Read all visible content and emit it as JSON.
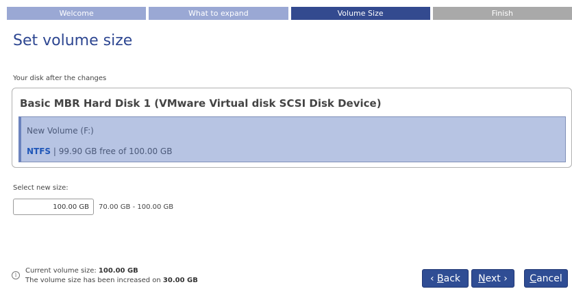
{
  "steps": [
    {
      "label": "Welcome",
      "state": "done"
    },
    {
      "label": "What to expand",
      "state": "done"
    },
    {
      "label": "Volume Size",
      "state": "active"
    },
    {
      "label": "Finish",
      "state": "pending"
    }
  ],
  "page": {
    "title": "Set volume size",
    "disk_section_label": "Your disk after the changes"
  },
  "disk": {
    "title": "Basic MBR Hard Disk 1 (VMware Virtual disk SCSI Disk Device)",
    "volume": {
      "name": "New Volume (F:)",
      "filesystem": "NTFS",
      "separator": " | ",
      "free_text": "99.90 GB free of 100.00 GB"
    }
  },
  "size": {
    "label": "Select new size:",
    "value": "100.00 GB",
    "range": "70.00 GB - 100.00 GB"
  },
  "info": {
    "icon": "info-icon",
    "icon_glyph": "i",
    "current_prefix": "Current volume size: ",
    "current_value": "100.00 GB",
    "increase_prefix": "The volume size has been increased on ",
    "increase_value": "30.00 GB"
  },
  "buttons": {
    "back_arrow": "‹ ",
    "back_key": "B",
    "back_rest": "ack",
    "next_key": "N",
    "next_rest": "ext",
    "next_arrow": " ›",
    "cancel_key": "C",
    "cancel_rest": "ancel"
  },
  "colors": {
    "step_done": "#9aa8d4",
    "step_active": "#334a8f",
    "step_pending": "#a9a9a9",
    "accent": "#2f4d94",
    "volume_fill": "#b7c4e3",
    "filesystem": "#1f56b8"
  }
}
